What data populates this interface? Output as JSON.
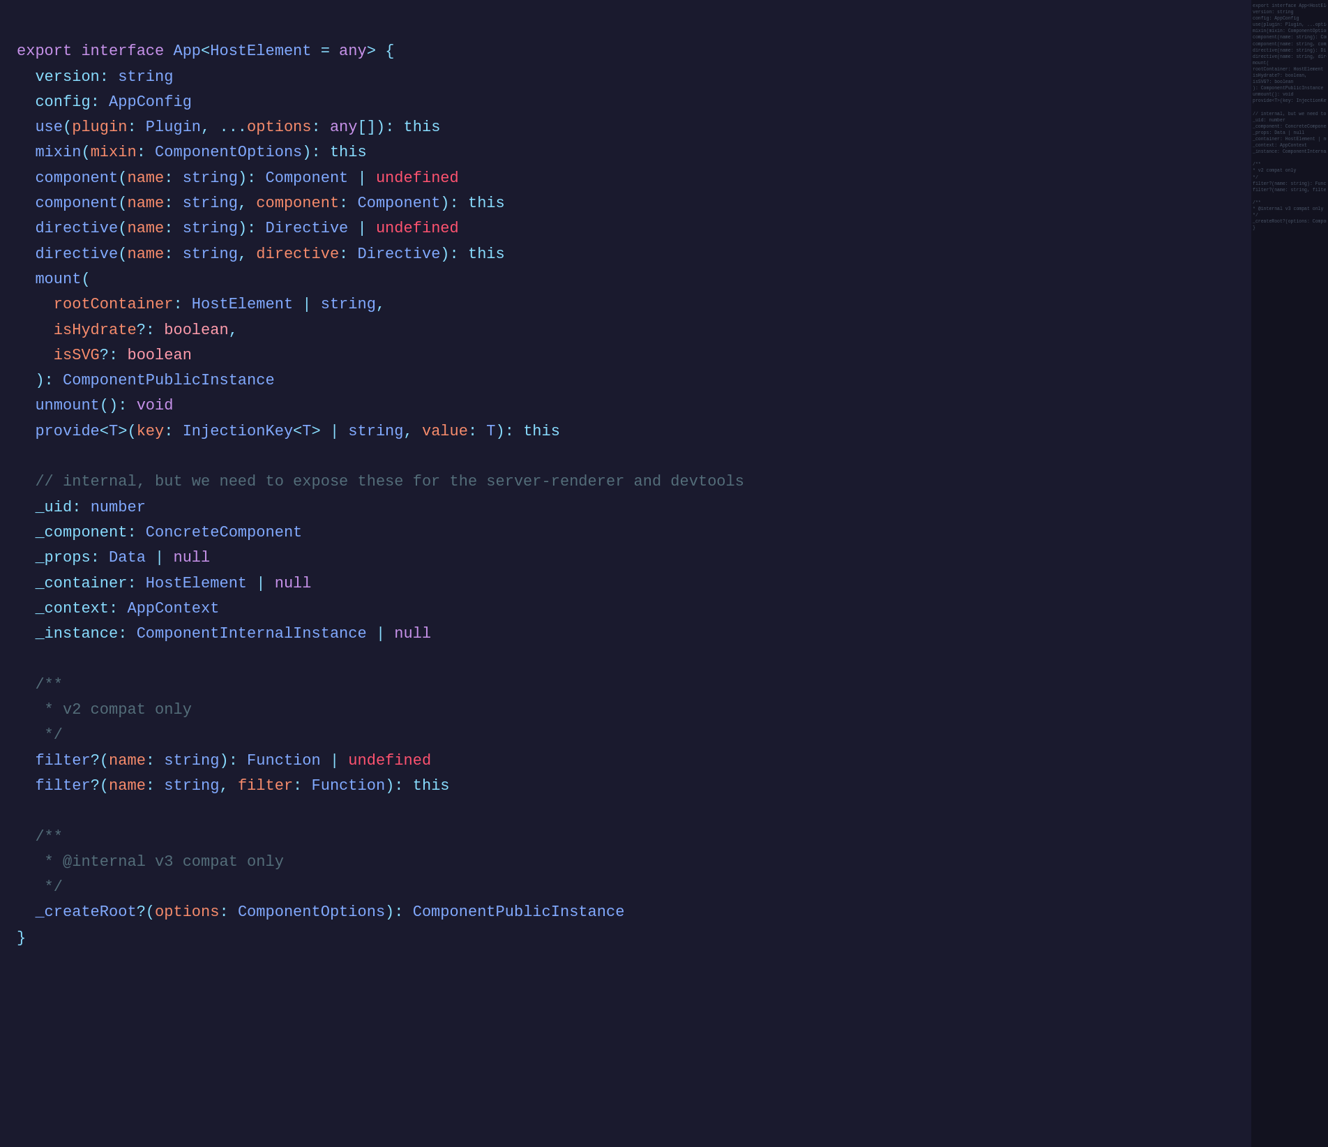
{
  "editor": {
    "background": "#1a1a2e",
    "sidebar_background": "#12121f"
  },
  "sidebar": {
    "lines": [
      "export interface App<HostElement = any> {",
      "  version: string",
      "  config: AppConfig",
      "  use(plugin: Plugin, ...options: any[]): this",
      "  mixin(mixin: ComponentOptions): this",
      "  component(name: string): Component | undefined",
      "  component(name: string, component: Component): this",
      "  directive(name: string): Directive | undefined",
      "  directive(name: string, directive: Directive): this",
      "  mount(",
      "    rootContainer: HostElement | string,",
      "    isHydrate?: boolean,",
      "    isSVG?: boolean",
      "  ): ComponentPublicInstance",
      "  unmount(): void",
      "  provide<T>(key: InjectionKey<T> | string, value: T): this",
      "",
      "  // internal, but we need to expose these for the server-renderer and devtools",
      "  _uid: number",
      "  _component: ConcreteComponent",
      "  _props: Data | null",
      "  _container: HostElement | null",
      "  _context: AppContext",
      "  _instance: ComponentInternalInstance | null",
      "",
      "  /**",
      "   * v2 compat only",
      "   */",
      "  filter?(name: string): Function | undefined",
      "  filter?(name: string, filter: Function): this",
      "",
      "  /**",
      "   * @internal v3 compat only",
      "   */",
      "  _createRoot?(options: ComponentOptions): ComponentPublicInstance",
      "}"
    ]
  }
}
